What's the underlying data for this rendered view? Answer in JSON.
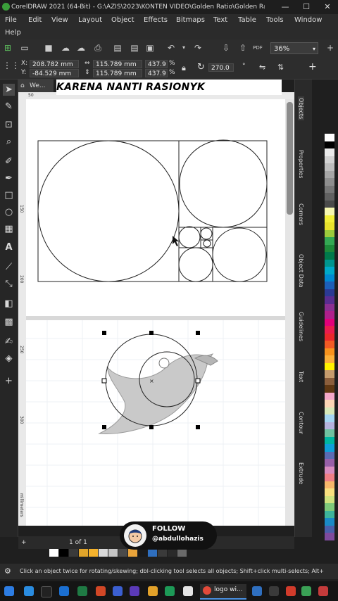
{
  "window": {
    "title": "CorelDRAW 2021 (64-Bit) - G:\\AZIS\\2023\\KONTEN VIDEO\\Golden Ratio\\Golden Rati...*",
    "minimize": "—",
    "maximize": "☐",
    "close": "✕"
  },
  "menu": {
    "items": [
      "File",
      "Edit",
      "View",
      "Layout",
      "Object",
      "Effects",
      "Bitmaps",
      "Text",
      "Table",
      "Tools",
      "Window"
    ],
    "help": "Help"
  },
  "toolbar": {
    "zoom": "36%",
    "pdf_label": "PDF"
  },
  "property_bar": {
    "x_label": "X:",
    "x_value": "208.782 mm",
    "y_label": "Y:",
    "y_value": "-84.529 mm",
    "w_value": "115.789 mm",
    "h_value": "115.789 mm",
    "w_scale": "437.9",
    "h_scale": "437.9",
    "percent": "%",
    "rotation": "270.0",
    "degree": "°"
  },
  "document": {
    "tab_label": "We...",
    "ruler_mark": "50"
  },
  "canvas": {
    "headline": "KARENA NANTI RASIONYK",
    "ruler_labels": [
      "150",
      "200",
      "250",
      "300"
    ],
    "vertical_ruler_unit": "millimeters"
  },
  "dockers": {
    "tabs": [
      "Objects",
      "Properties",
      "Corners",
      "Object Data",
      "Guidelines",
      "Text",
      "Contour",
      "Extrude"
    ]
  },
  "pagebar": {
    "page_info": "1 of 1",
    "plus": "+"
  },
  "status": {
    "hint": "Click an object twice for rotating/skewing; dbl-clicking tool selects all objects; Shift+click multi-selects; Alt+"
  },
  "overlay": {
    "follow_label": "FOLLOW",
    "handle": "@abdullohazis"
  },
  "taskbar": {
    "active_app": "logo wi..."
  },
  "colors": {
    "palette": [
      "#ffffff",
      "#000000",
      "#eaeaea",
      "#d2d2d2",
      "#bdbdbd",
      "#a6a6a6",
      "#8e8e8e",
      "#777777",
      "#616161",
      "#4b4b4b",
      "#f7f8b0",
      "#f2ef39",
      "#e8e22c",
      "#9ccc3c",
      "#34a853",
      "#1e8a3a",
      "#007a4b",
      "#00958f",
      "#00a9c9",
      "#0089d1",
      "#1d5fb8",
      "#2b3a94",
      "#5a2d91",
      "#8c2f92",
      "#b0208c",
      "#e2007a",
      "#ea1c4e",
      "#e9282b",
      "#f15a24",
      "#f7931e",
      "#fbb03b",
      "#fff200",
      "#c69c6d",
      "#8b5e3c",
      "#603813",
      "#f4a8c8",
      "#fcd5b5",
      "#d7e8b8",
      "#a5d6f2",
      "#b6b3dd",
      "#70c2a0",
      "#00b6a1",
      "#0f9fd8",
      "#5b6bb3",
      "#9860a8",
      "#d88cbf",
      "#ef7f86",
      "#f8b76b",
      "#f9e07f",
      "#cfe27f",
      "#7ec97a",
      "#3db49b",
      "#1a8ac6",
      "#4a5fab",
      "#7e4a9d"
    ],
    "strip": [
      "#ffffff",
      "#000000",
      "#3a3a3a",
      "#e0a42a",
      "#f5b32d",
      "#d9d9d9",
      "#c4c4c4",
      "#4a4a4a",
      "#e8a33a",
      "#1a1a1a",
      "#2f6fbf",
      "#3a3a3a",
      "#2a2a2a",
      "#6a6a6a"
    ],
    "accent": "#3a9e3a"
  }
}
